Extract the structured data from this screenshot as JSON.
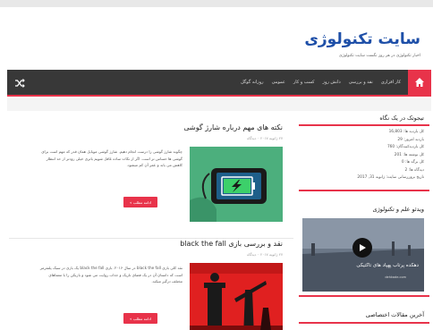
{
  "site": {
    "title": "سایت تکنولوژی",
    "description": "اخبار تکنولوژی در هر روز نگست سایت تکنولوژی"
  },
  "nav": {
    "items": [
      "کار افزاری",
      "نقد و بررسی",
      "دانش روز",
      "کسب و کار",
      "عمومی",
      "روزانه گوگل"
    ]
  },
  "posts": [
    {
      "title": "نکته های مهم درباره شارژ گوشی",
      "meta": "۲۷ ژانویه ۲۰۱۷  ۰  دیدگاه",
      "excerpt": "چگونه شارژ گوشی را درست انجام دهیم. شارژ گوشی موبایل همان قدر که مهم است برای گوشی ها حساس تر است. اگر از نکات ساده غافل شویم باتری خیلی زودتر از حد انتظار کاهش می یابد و عمر آن کم میشود.",
      "more": "ادامه مطلب »"
    },
    {
      "title": "نقد و بررسی بازی black the fall",
      "meta": "۲۷ ژانویه ۲۰۱۷  ۰  دیدگاه",
      "excerpt": "نقد کلی بازی black the fall در سال ۲۰۱۶. بازی black the fall یک بازی در سبک پلتفرمر است که داستان آن در یک فضای تاریک و جذاب روایت می شود و بازیکن را با معماهای مختلف درگیر میکند.",
      "more": "ادامه مطلب »"
    }
  ],
  "sidebar": {
    "stats_title": "تیجوتک در یک نگاه",
    "stats": [
      "کل بازدید ها: 16,803",
      "بازدید امروز: 29",
      "کل بازدیدکنندگان: 760",
      "کل نوشته ها: 201",
      "کل برگه ها: 0",
      "دیدگاه ها: 2",
      "تاریخ بروزرسانی سایت: ژانویه 31, 2017"
    ],
    "video_title": "ویدئو علم و تکنولوژی",
    "video_caption": "دهکده پرتاب پهپاد های تاکتیکی",
    "video_sub": "dehkade.com",
    "articles_title": "آخرین مقالات اختصاصی"
  },
  "colors": {
    "accent": "#e8334a",
    "nav_bg": "#383838",
    "title_blue": "#1e4fa8"
  }
}
